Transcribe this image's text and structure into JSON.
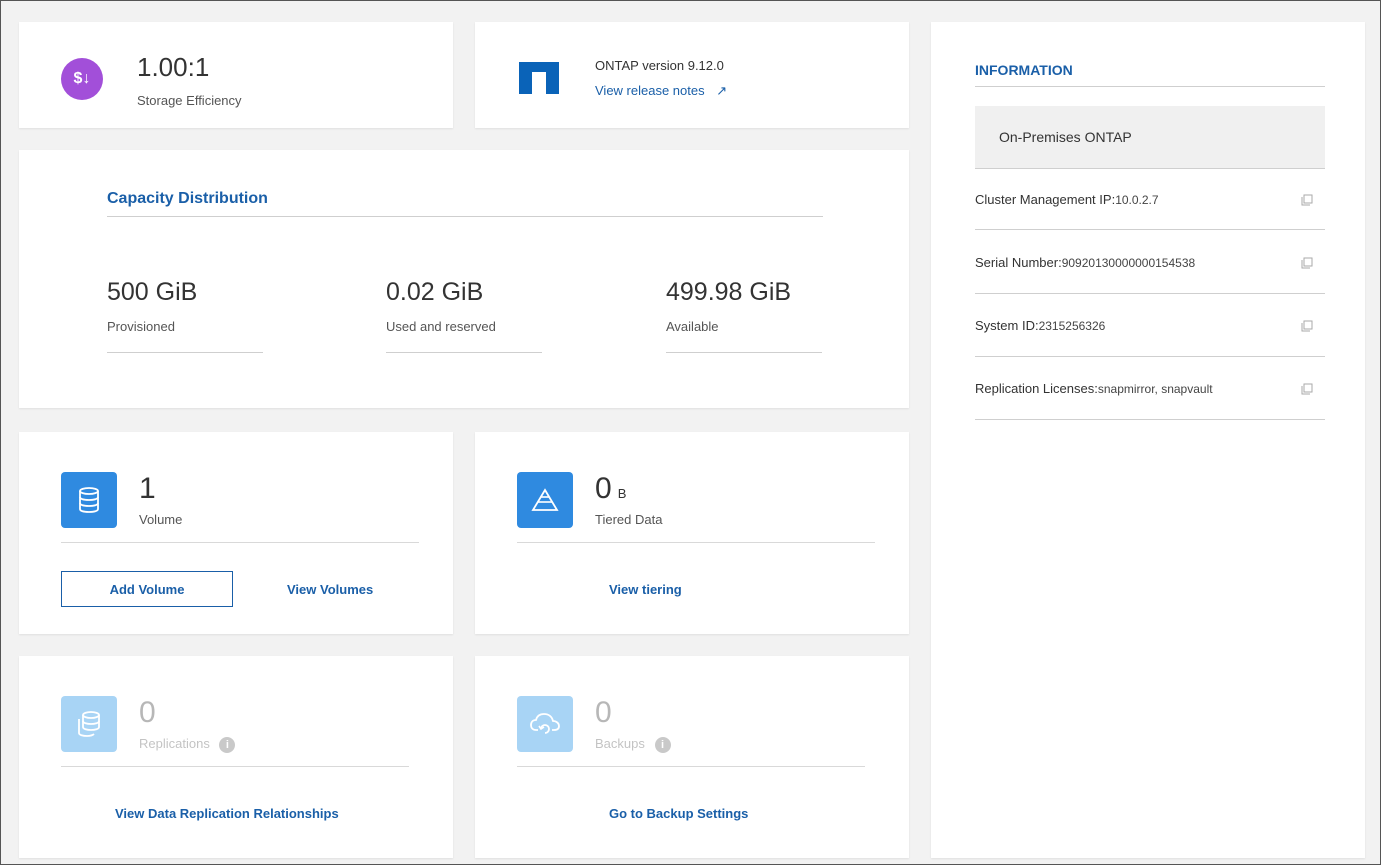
{
  "storage_efficiency": {
    "value": "1.00:1",
    "label": "Storage Efficiency",
    "icon": "dollar-down-icon"
  },
  "ontap": {
    "version_label": "ONTAP version 9.12.0",
    "release_notes_link": "View release notes",
    "arrow": "↗"
  },
  "capacity": {
    "title": "Capacity Distribution",
    "items": [
      {
        "value": "500 GiB",
        "label": "Provisioned"
      },
      {
        "value": "0.02 GiB",
        "label": "Used and reserved"
      },
      {
        "value": "499.98 GiB",
        "label": "Available"
      }
    ]
  },
  "volume": {
    "count": "1",
    "label": "Volume",
    "add_button": "Add Volume",
    "view_link": "View Volumes"
  },
  "tiered": {
    "count": "0",
    "unit": "B",
    "label": "Tiered Data",
    "view_link": "View tiering"
  },
  "replications": {
    "count": "0",
    "label": "Replications",
    "view_link": "View Data Replication Relationships"
  },
  "backups": {
    "count": "0",
    "label": "Backups",
    "view_link": "Go to Backup Settings"
  },
  "information": {
    "title": "INFORMATION",
    "type": "On-Premises ONTAP",
    "rows": [
      {
        "key": "Cluster Management IP:",
        "value": "10.0.2.7"
      },
      {
        "key": "Serial Number:",
        "value": "909201300000001545​38"
      },
      {
        "key": "System ID:",
        "value": "2315256326"
      },
      {
        "key": "Replication Licenses:",
        "value": "snapmirror, snapvault"
      }
    ]
  },
  "colors": {
    "accent": "#1a5fa8",
    "purple": "#a24fd9",
    "tile_blue": "#2f8ae0",
    "faded_blue": "#a8d4f5"
  }
}
